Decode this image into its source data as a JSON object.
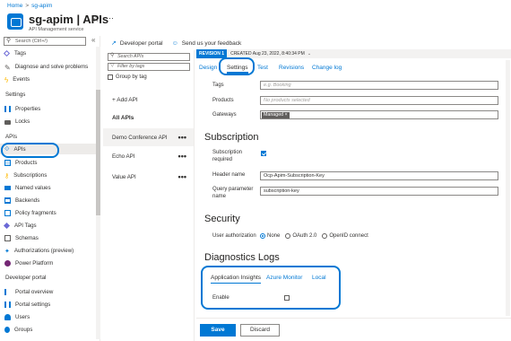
{
  "breadcrumb": {
    "home": "Home",
    "sep": ">",
    "current": "sg-apim"
  },
  "header": {
    "title": "sg-apim | APIs",
    "subtitle": "API Management service",
    "star_icon": "star-icon",
    "more": "···"
  },
  "sidebar": {
    "search_placeholder": "Search (Ctrl+/)",
    "collapse": "«",
    "items_top": [
      {
        "label": "Tags",
        "icon": "tag-icon"
      },
      {
        "label": "Diagnose and solve problems",
        "icon": "wrench-icon"
      },
      {
        "label": "Events",
        "icon": "bolt-icon"
      }
    ],
    "settings_header": "Settings",
    "settings_items": [
      {
        "label": "Properties",
        "icon": "properties-icon"
      },
      {
        "label": "Locks",
        "icon": "lock-icon"
      }
    ],
    "apis_header": "APIs",
    "apis_items": [
      {
        "label": "APIs",
        "icon": "api-icon"
      },
      {
        "label": "Products",
        "icon": "products-icon"
      },
      {
        "label": "Subscriptions",
        "icon": "key-icon"
      },
      {
        "label": "Named values",
        "icon": "named-values-icon"
      },
      {
        "label": "Backends",
        "icon": "backends-icon"
      },
      {
        "label": "Policy fragments",
        "icon": "fragment-icon"
      },
      {
        "label": "API Tags",
        "icon": "tag-icon"
      },
      {
        "label": "Schemas",
        "icon": "schema-icon"
      },
      {
        "label": "Authorizations (preview)",
        "icon": "authorization-icon"
      },
      {
        "label": "Power Platform",
        "icon": "power-platform-icon"
      }
    ],
    "portal_header": "Developer portal",
    "portal_items": [
      {
        "label": "Portal overview",
        "icon": "portal-icon"
      },
      {
        "label": "Portal settings",
        "icon": "portal-settings-icon"
      },
      {
        "label": "Users",
        "icon": "user-icon"
      },
      {
        "label": "Groups",
        "icon": "groups-icon"
      }
    ]
  },
  "toolbar": {
    "developer_portal": "Developer portal",
    "feedback": "Send us your feedback"
  },
  "api_list": {
    "search_placeholder": "Search APIs",
    "filter_placeholder": "Filter by tags",
    "group_by_tag": "Group by tag",
    "add_api": "+ Add API",
    "all_apis": "All APIs",
    "apis": [
      {
        "name": "Demo Conference API",
        "more": "•••"
      },
      {
        "name": "Echo API",
        "more": "•••"
      },
      {
        "name": "Value API",
        "more": "•••"
      }
    ]
  },
  "revision": {
    "badge": "REVISION 1",
    "created": "CREATED Aug 23, 2022, 8:40:34 PM"
  },
  "tabs": [
    "Design",
    "Settings",
    "Test",
    "Revisions",
    "Change log"
  ],
  "form": {
    "tags_label": "Tags",
    "tags_placeholder": "e.g. Booking",
    "products_label": "Products",
    "products_placeholder": "No products selected",
    "gateways_label": "Gateways",
    "gateways_chip": "Managed ×"
  },
  "subscription": {
    "title": "Subscription",
    "required_label": "Subscription required",
    "header_name_label": "Header name",
    "header_name_value": "Ocp-Apim-Subscription-Key",
    "query_param_label": "Query parameter name",
    "query_param_value": "subscription-key"
  },
  "security": {
    "title": "Security",
    "user_auth_label": "User authorization",
    "options": [
      "None",
      "OAuth 2.0",
      "OpenID connect"
    ],
    "selected": "None"
  },
  "diagnostics": {
    "title": "Diagnostics Logs",
    "tabs": [
      "Application Insights",
      "Azure Monitor",
      "Local"
    ],
    "enable_label": "Enable"
  },
  "buttons": {
    "save": "Save",
    "discard": "Discard"
  },
  "colors": {
    "accent": "#0078d4"
  }
}
